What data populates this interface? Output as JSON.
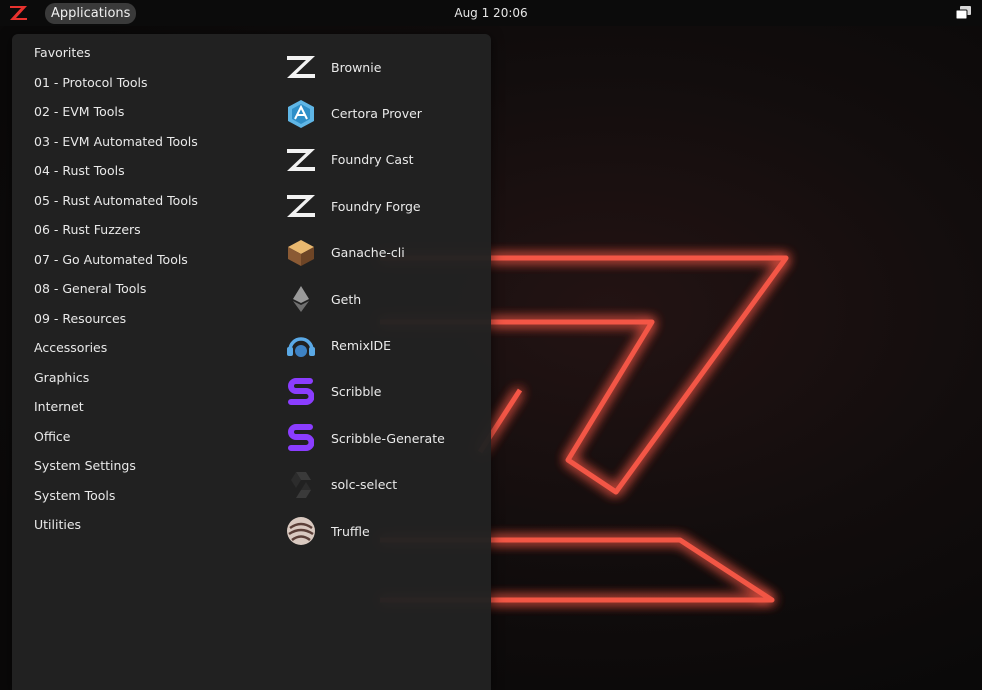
{
  "topbar": {
    "activities_icon": "zeppelin-logo-icon",
    "applications_label": "Applications",
    "clock": "Aug 1  20:06",
    "system_icon": "system-tray-icon"
  },
  "menu": {
    "categories": [
      {
        "label": "Favorites"
      },
      {
        "label": "01 - Protocol Tools"
      },
      {
        "label": "02 - EVM Tools"
      },
      {
        "label": "03 - EVM Automated Tools"
      },
      {
        "label": "04 - Rust Tools"
      },
      {
        "label": "05 - Rust Automated Tools"
      },
      {
        "label": "06 - Rust Fuzzers"
      },
      {
        "label": "07 - Go Automated Tools"
      },
      {
        "label": "08 - General Tools"
      },
      {
        "label": "09 - Resources"
      },
      {
        "label": "Accessories"
      },
      {
        "label": "Graphics"
      },
      {
        "label": "Internet"
      },
      {
        "label": "Office"
      },
      {
        "label": "System Settings"
      },
      {
        "label": "System Tools"
      },
      {
        "label": "Utilities"
      }
    ],
    "apps": [
      {
        "label": "Brownie",
        "icon": "brownie-icon"
      },
      {
        "label": "Certora Prover",
        "icon": "certora-icon"
      },
      {
        "label": "Foundry Cast",
        "icon": "foundry-cast-icon"
      },
      {
        "label": "Foundry Forge",
        "icon": "foundry-forge-icon"
      },
      {
        "label": "Ganache-cli",
        "icon": "ganache-icon"
      },
      {
        "label": "Geth",
        "icon": "ethereum-icon"
      },
      {
        "label": "RemixIDE",
        "icon": "remix-icon"
      },
      {
        "label": "Scribble",
        "icon": "scribble-icon"
      },
      {
        "label": "Scribble-Generate",
        "icon": "scribble-generate-icon"
      },
      {
        "label": "solc-select",
        "icon": "solc-icon"
      },
      {
        "label": "Truffle",
        "icon": "truffle-icon"
      }
    ]
  },
  "colors": {
    "accent_red": "#e8322e",
    "neon_red": "#ff5a4a",
    "menu_bg": "#222222",
    "scribble_purple": "#8b3dff"
  }
}
